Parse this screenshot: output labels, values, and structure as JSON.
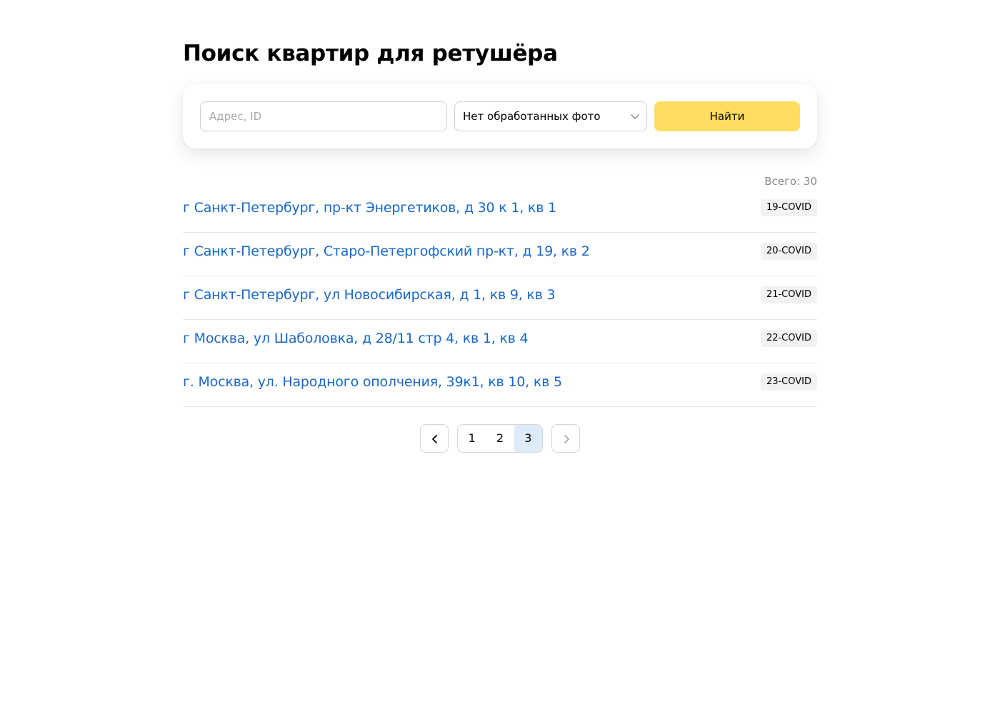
{
  "page": {
    "title": "Поиск квартир для ретушёра"
  },
  "search": {
    "placeholder": "Адрес, ID",
    "value": "",
    "filter_selected": "Нет обработанных фото",
    "submit_label": "Найти"
  },
  "results": {
    "total_label": "Всего: 30",
    "items": [
      {
        "address": "г Санкт-Петербург, пр-кт Энергетиков, д 30 к 1, кв 1",
        "badge": "19-COVID"
      },
      {
        "address": "г Санкт-Петербург, Старо-Петергофский пр-кт, д 19, кв 2",
        "badge": "20-COVID"
      },
      {
        "address": "г Санкт-Петербург, ул Новосибирская, д 1, кв 9, кв 3",
        "badge": "21-COVID"
      },
      {
        "address": "г Москва, ул Шаболовка, д 28/11 стр 4, кв 1, кв 4",
        "badge": "22-COVID"
      },
      {
        "address": "г. Москва, ул. Народного ополчения, 39к1, кв 10, кв 5",
        "badge": "23-COVID"
      }
    ]
  },
  "pagination": {
    "pages": [
      "1",
      "2",
      "3"
    ],
    "current": "3"
  },
  "colors": {
    "link": "#1868c8",
    "accent_button": "#ffdd60",
    "active_page": "#deebfb",
    "badge_bg": "#f2f2f2"
  },
  "icons": {
    "select_arrow": "chevron-down-icon",
    "prev": "chevron-left-icon",
    "next": "chevron-right-icon"
  }
}
